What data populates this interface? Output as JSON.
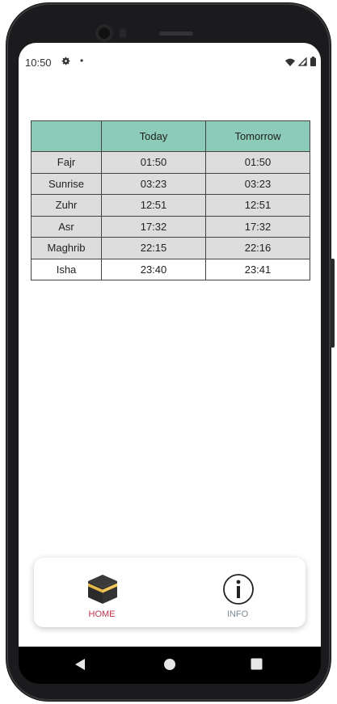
{
  "status_bar": {
    "time": "10:50",
    "icons": [
      "gear-icon",
      "notification-dot-icon",
      "wifi-icon",
      "signal-icon",
      "battery-icon"
    ]
  },
  "prayer_table": {
    "headers": [
      "",
      "Today",
      "Tomorrow"
    ],
    "rows": [
      {
        "name": "Fajr",
        "today": "01:50",
        "tomorrow": "01:50"
      },
      {
        "name": "Sunrise",
        "today": "03:23",
        "tomorrow": "03:23"
      },
      {
        "name": "Zuhr",
        "today": "12:51",
        "tomorrow": "12:51"
      },
      {
        "name": "Asr",
        "today": "17:32",
        "tomorrow": "17:32"
      },
      {
        "name": "Maghrib",
        "today": "22:15",
        "tomorrow": "22:16"
      },
      {
        "name": "Isha",
        "today": "23:40",
        "tomorrow": "23:41"
      }
    ]
  },
  "bottom_nav": {
    "items": [
      {
        "label": "HOME",
        "icon": "kaaba-icon",
        "active": true
      },
      {
        "label": "INFO",
        "icon": "info-icon",
        "active": false
      }
    ]
  },
  "colors": {
    "header_bg": "#8ccbb8",
    "row_bg": "#dddddd",
    "active_nav": "#c2334d",
    "inactive_nav": "#7a8a96"
  }
}
